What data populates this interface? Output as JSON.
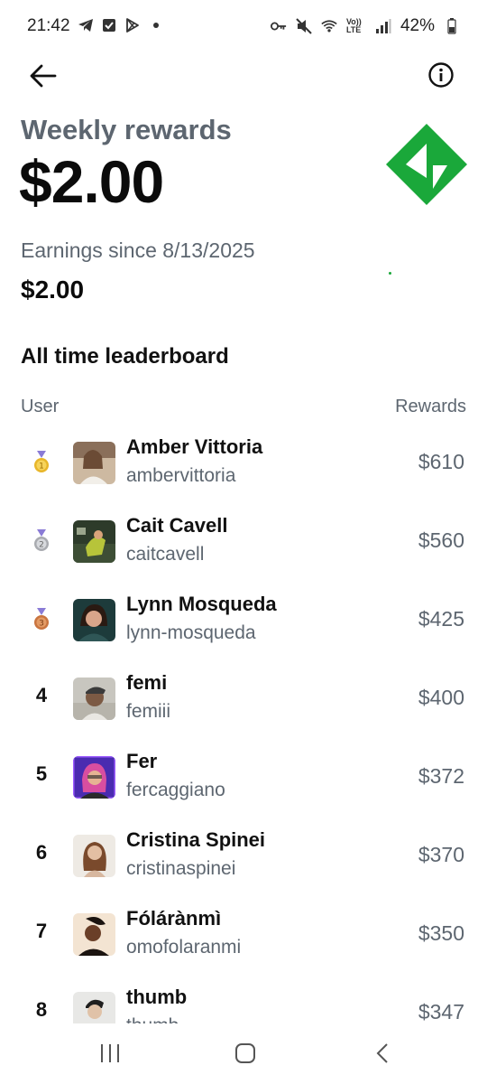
{
  "status_bar": {
    "time": "21:42",
    "battery": "42%",
    "left_icons": [
      "telegram-icon",
      "check-box-icon",
      "play-store-icon",
      "dot-icon"
    ],
    "right_icons": [
      "key-icon",
      "mute-icon",
      "wifi-icon",
      "volte-icon",
      "signal-icon",
      "battery-icon"
    ],
    "volte_label": "Vo)) LTE"
  },
  "header": {
    "back_icon": "back-arrow-icon",
    "info_icon": "info-icon"
  },
  "weekly": {
    "title": "Weekly rewards",
    "amount": "$2.00"
  },
  "logo": {
    "icon": "green-diamond-logo",
    "color": "#1aa83a"
  },
  "earnings": {
    "label": "Earnings since 8/13/2025",
    "amount": "$2.00"
  },
  "leaderboard": {
    "title": "All time leaderboard",
    "columns": {
      "user": "User",
      "rewards": "Rewards"
    },
    "rows": [
      {
        "rank": "",
        "medal": "gold-medal-icon",
        "name": "Amber Vittoria",
        "handle": "ambervittoria",
        "reward": "$610"
      },
      {
        "rank": "",
        "medal": "silver-medal-icon",
        "name": "Cait Cavell",
        "handle": "caitcavell",
        "reward": "$560"
      },
      {
        "rank": "",
        "medal": "bronze-medal-icon",
        "name": "Lynn Mosqueda",
        "handle": "lynn-mosqueda",
        "reward": "$425"
      },
      {
        "rank": "4",
        "medal": "",
        "name": "femi",
        "handle": "femiii",
        "reward": "$400"
      },
      {
        "rank": "5",
        "medal": "",
        "name": "Fer",
        "handle": "fercaggiano",
        "reward": "$372"
      },
      {
        "rank": "6",
        "medal": "",
        "name": "Cristina Spinei",
        "handle": "cristinaspinei",
        "reward": "$370"
      },
      {
        "rank": "7",
        "medal": "",
        "name": "Fólárànmì",
        "handle": "omofolaranmi",
        "reward": "$350"
      },
      {
        "rank": "8",
        "medal": "",
        "name": "thumb",
        "handle": "thumb",
        "reward": "$347"
      }
    ]
  },
  "nav": {
    "recents_icon": "recents-icon",
    "home_icon": "home-icon",
    "back_icon": "nav-back-icon"
  }
}
